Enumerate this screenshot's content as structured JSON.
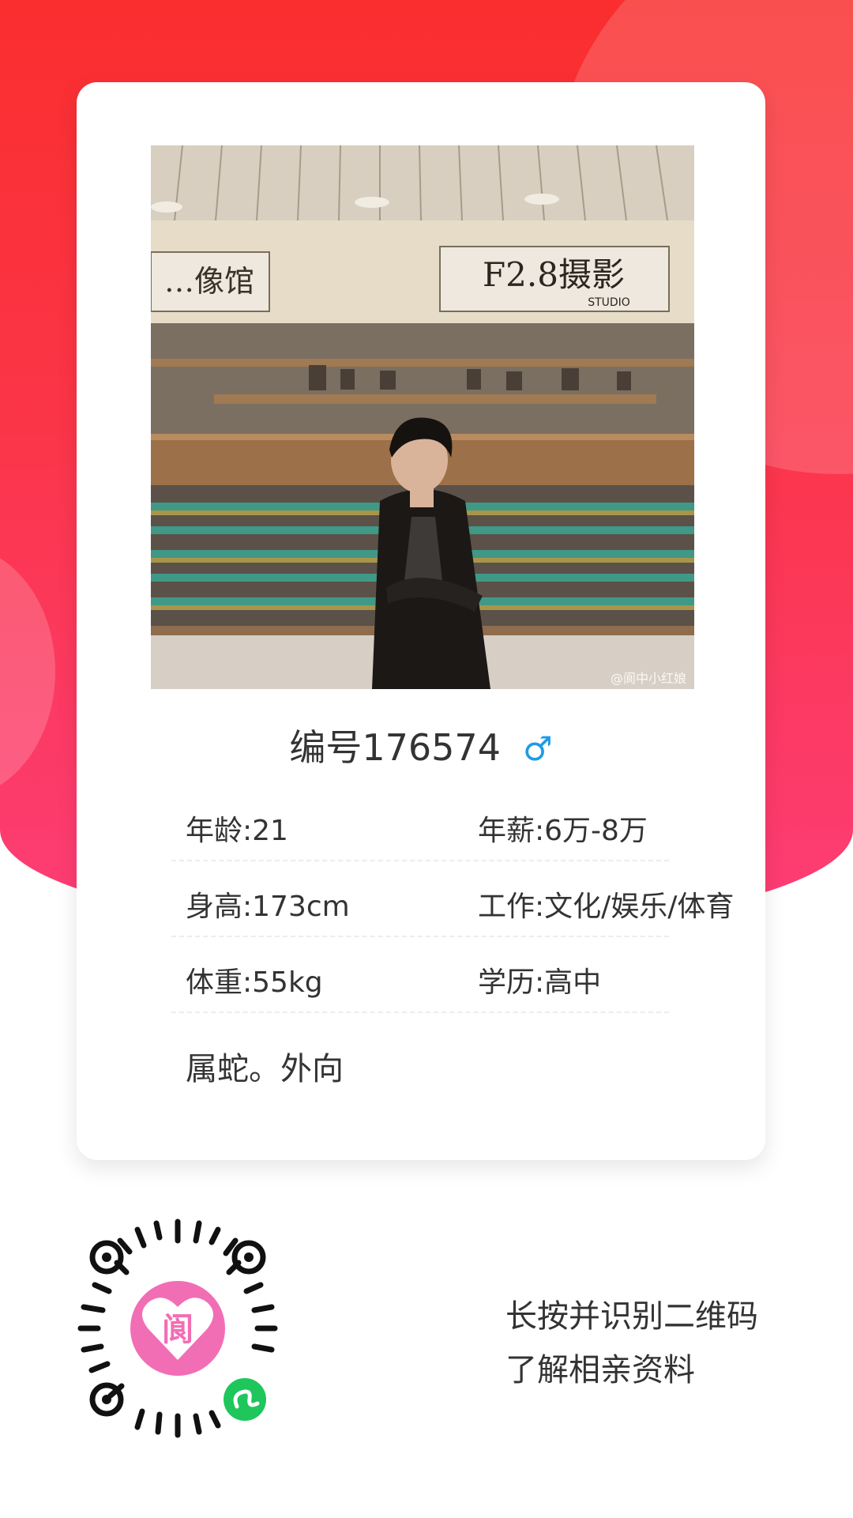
{
  "profile": {
    "title": "编号176574",
    "gender_symbol": "♂",
    "photo_watermark": "@阆中小红娘",
    "sign_left": "…像馆",
    "sign_right": "F2.8摄影",
    "sign_right_sub": "STUDIO",
    "info": [
      {
        "left": "年龄:21",
        "right": "年薪:6万-8万"
      },
      {
        "left": "身高:173cm",
        "right": "工作:文化/娱乐/体育"
      },
      {
        "left": "体重:55kg",
        "right": "学历:高中"
      }
    ],
    "description": "属蛇。外向"
  },
  "footer": {
    "qr_center_char": "阆",
    "hint_line1": "长按并识别二维码",
    "hint_line2": "了解相亲资料"
  },
  "colors": {
    "bg_top": "#fa2e2e",
    "bg_bottom": "#fd3d77",
    "gender_blue": "#1e9be6",
    "qr_pink": "#f16eb5",
    "miniapp_green": "#1ec65c"
  }
}
